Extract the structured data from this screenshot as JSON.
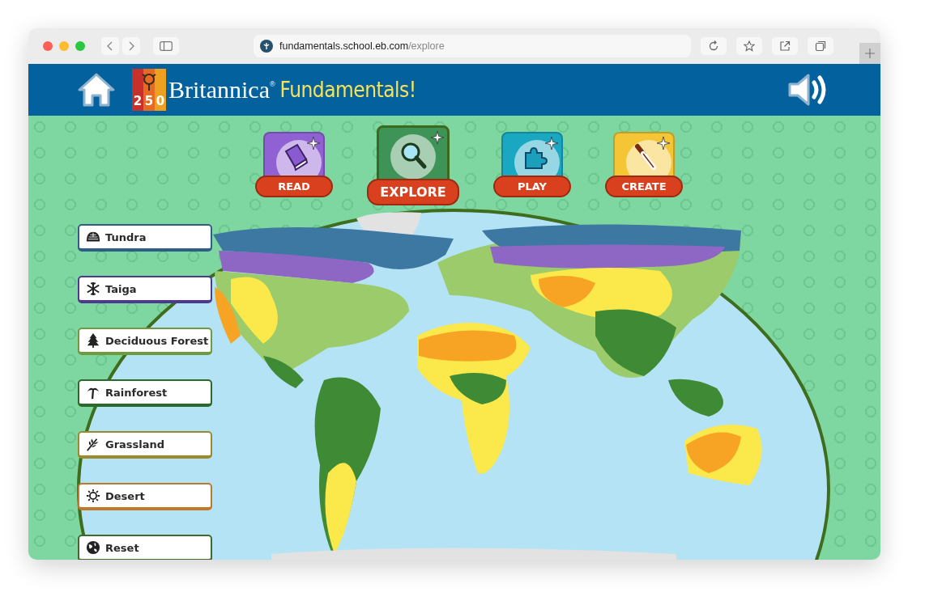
{
  "browser": {
    "url_host": "fundamentals.school.eb.com",
    "url_path": "/explore"
  },
  "header": {
    "logo_digits": [
      "2",
      "5",
      "0"
    ],
    "brand": "Britannica",
    "brand_mark": "®",
    "product": "Fundamentals!"
  },
  "nav": [
    {
      "label": "READ",
      "kind": "read",
      "color": "#9061d3",
      "selected": false
    },
    {
      "label": "EXPLORE",
      "kind": "explore",
      "color": "#3e9457",
      "selected": true
    },
    {
      "label": "PLAY",
      "kind": "play",
      "color": "#19a7c2",
      "selected": false
    },
    {
      "label": "CREATE",
      "kind": "create",
      "color": "#f4c534",
      "selected": false
    }
  ],
  "biomes": [
    {
      "label": "Tundra",
      "kind": "tundra",
      "color": "#2f5f86"
    },
    {
      "label": "Taiga",
      "kind": "taiga",
      "color": "#4d3a8e"
    },
    {
      "label": "Deciduous Forest",
      "kind": "deciduous",
      "color": "#6f9a3f"
    },
    {
      "label": "Rainforest",
      "kind": "rainforest",
      "color": "#2b6a2a"
    },
    {
      "label": "Grassland",
      "kind": "grassland",
      "color": "#9b8a2c"
    },
    {
      "label": "Desert",
      "kind": "desert",
      "color": "#c0782a"
    },
    {
      "label": "Reset",
      "kind": "reset",
      "color": "#3f6b2a"
    }
  ]
}
